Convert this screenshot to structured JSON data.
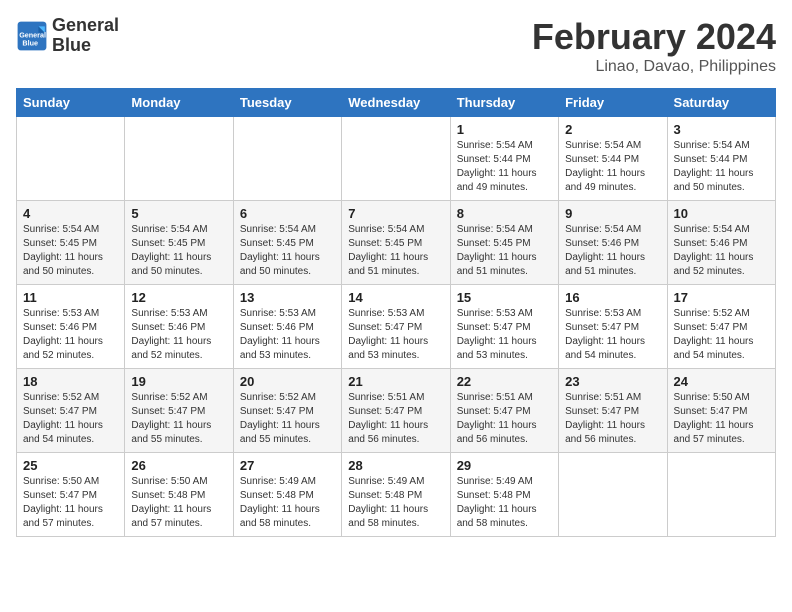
{
  "logo": {
    "line1": "General",
    "line2": "Blue"
  },
  "title": "February 2024",
  "subtitle": "Linao, Davao, Philippines",
  "days_of_week": [
    "Sunday",
    "Monday",
    "Tuesday",
    "Wednesday",
    "Thursday",
    "Friday",
    "Saturday"
  ],
  "weeks": [
    [
      {
        "num": "",
        "sunrise": "",
        "sunset": "",
        "daylight": ""
      },
      {
        "num": "",
        "sunrise": "",
        "sunset": "",
        "daylight": ""
      },
      {
        "num": "",
        "sunrise": "",
        "sunset": "",
        "daylight": ""
      },
      {
        "num": "",
        "sunrise": "",
        "sunset": "",
        "daylight": ""
      },
      {
        "num": "1",
        "sunrise": "5:54 AM",
        "sunset": "5:44 PM",
        "daylight": "11 hours and 49 minutes."
      },
      {
        "num": "2",
        "sunrise": "5:54 AM",
        "sunset": "5:44 PM",
        "daylight": "11 hours and 49 minutes."
      },
      {
        "num": "3",
        "sunrise": "5:54 AM",
        "sunset": "5:44 PM",
        "daylight": "11 hours and 50 minutes."
      }
    ],
    [
      {
        "num": "4",
        "sunrise": "5:54 AM",
        "sunset": "5:45 PM",
        "daylight": "11 hours and 50 minutes."
      },
      {
        "num": "5",
        "sunrise": "5:54 AM",
        "sunset": "5:45 PM",
        "daylight": "11 hours and 50 minutes."
      },
      {
        "num": "6",
        "sunrise": "5:54 AM",
        "sunset": "5:45 PM",
        "daylight": "11 hours and 50 minutes."
      },
      {
        "num": "7",
        "sunrise": "5:54 AM",
        "sunset": "5:45 PM",
        "daylight": "11 hours and 51 minutes."
      },
      {
        "num": "8",
        "sunrise": "5:54 AM",
        "sunset": "5:45 PM",
        "daylight": "11 hours and 51 minutes."
      },
      {
        "num": "9",
        "sunrise": "5:54 AM",
        "sunset": "5:46 PM",
        "daylight": "11 hours and 51 minutes."
      },
      {
        "num": "10",
        "sunrise": "5:54 AM",
        "sunset": "5:46 PM",
        "daylight": "11 hours and 52 minutes."
      }
    ],
    [
      {
        "num": "11",
        "sunrise": "5:53 AM",
        "sunset": "5:46 PM",
        "daylight": "11 hours and 52 minutes."
      },
      {
        "num": "12",
        "sunrise": "5:53 AM",
        "sunset": "5:46 PM",
        "daylight": "11 hours and 52 minutes."
      },
      {
        "num": "13",
        "sunrise": "5:53 AM",
        "sunset": "5:46 PM",
        "daylight": "11 hours and 53 minutes."
      },
      {
        "num": "14",
        "sunrise": "5:53 AM",
        "sunset": "5:47 PM",
        "daylight": "11 hours and 53 minutes."
      },
      {
        "num": "15",
        "sunrise": "5:53 AM",
        "sunset": "5:47 PM",
        "daylight": "11 hours and 53 minutes."
      },
      {
        "num": "16",
        "sunrise": "5:53 AM",
        "sunset": "5:47 PM",
        "daylight": "11 hours and 54 minutes."
      },
      {
        "num": "17",
        "sunrise": "5:52 AM",
        "sunset": "5:47 PM",
        "daylight": "11 hours and 54 minutes."
      }
    ],
    [
      {
        "num": "18",
        "sunrise": "5:52 AM",
        "sunset": "5:47 PM",
        "daylight": "11 hours and 54 minutes."
      },
      {
        "num": "19",
        "sunrise": "5:52 AM",
        "sunset": "5:47 PM",
        "daylight": "11 hours and 55 minutes."
      },
      {
        "num": "20",
        "sunrise": "5:52 AM",
        "sunset": "5:47 PM",
        "daylight": "11 hours and 55 minutes."
      },
      {
        "num": "21",
        "sunrise": "5:51 AM",
        "sunset": "5:47 PM",
        "daylight": "11 hours and 56 minutes."
      },
      {
        "num": "22",
        "sunrise": "5:51 AM",
        "sunset": "5:47 PM",
        "daylight": "11 hours and 56 minutes."
      },
      {
        "num": "23",
        "sunrise": "5:51 AM",
        "sunset": "5:47 PM",
        "daylight": "11 hours and 56 minutes."
      },
      {
        "num": "24",
        "sunrise": "5:50 AM",
        "sunset": "5:47 PM",
        "daylight": "11 hours and 57 minutes."
      }
    ],
    [
      {
        "num": "25",
        "sunrise": "5:50 AM",
        "sunset": "5:47 PM",
        "daylight": "11 hours and 57 minutes."
      },
      {
        "num": "26",
        "sunrise": "5:50 AM",
        "sunset": "5:48 PM",
        "daylight": "11 hours and 57 minutes."
      },
      {
        "num": "27",
        "sunrise": "5:49 AM",
        "sunset": "5:48 PM",
        "daylight": "11 hours and 58 minutes."
      },
      {
        "num": "28",
        "sunrise": "5:49 AM",
        "sunset": "5:48 PM",
        "daylight": "11 hours and 58 minutes."
      },
      {
        "num": "29",
        "sunrise": "5:49 AM",
        "sunset": "5:48 PM",
        "daylight": "11 hours and 58 minutes."
      },
      {
        "num": "",
        "sunrise": "",
        "sunset": "",
        "daylight": ""
      },
      {
        "num": "",
        "sunrise": "",
        "sunset": "",
        "daylight": ""
      }
    ]
  ]
}
